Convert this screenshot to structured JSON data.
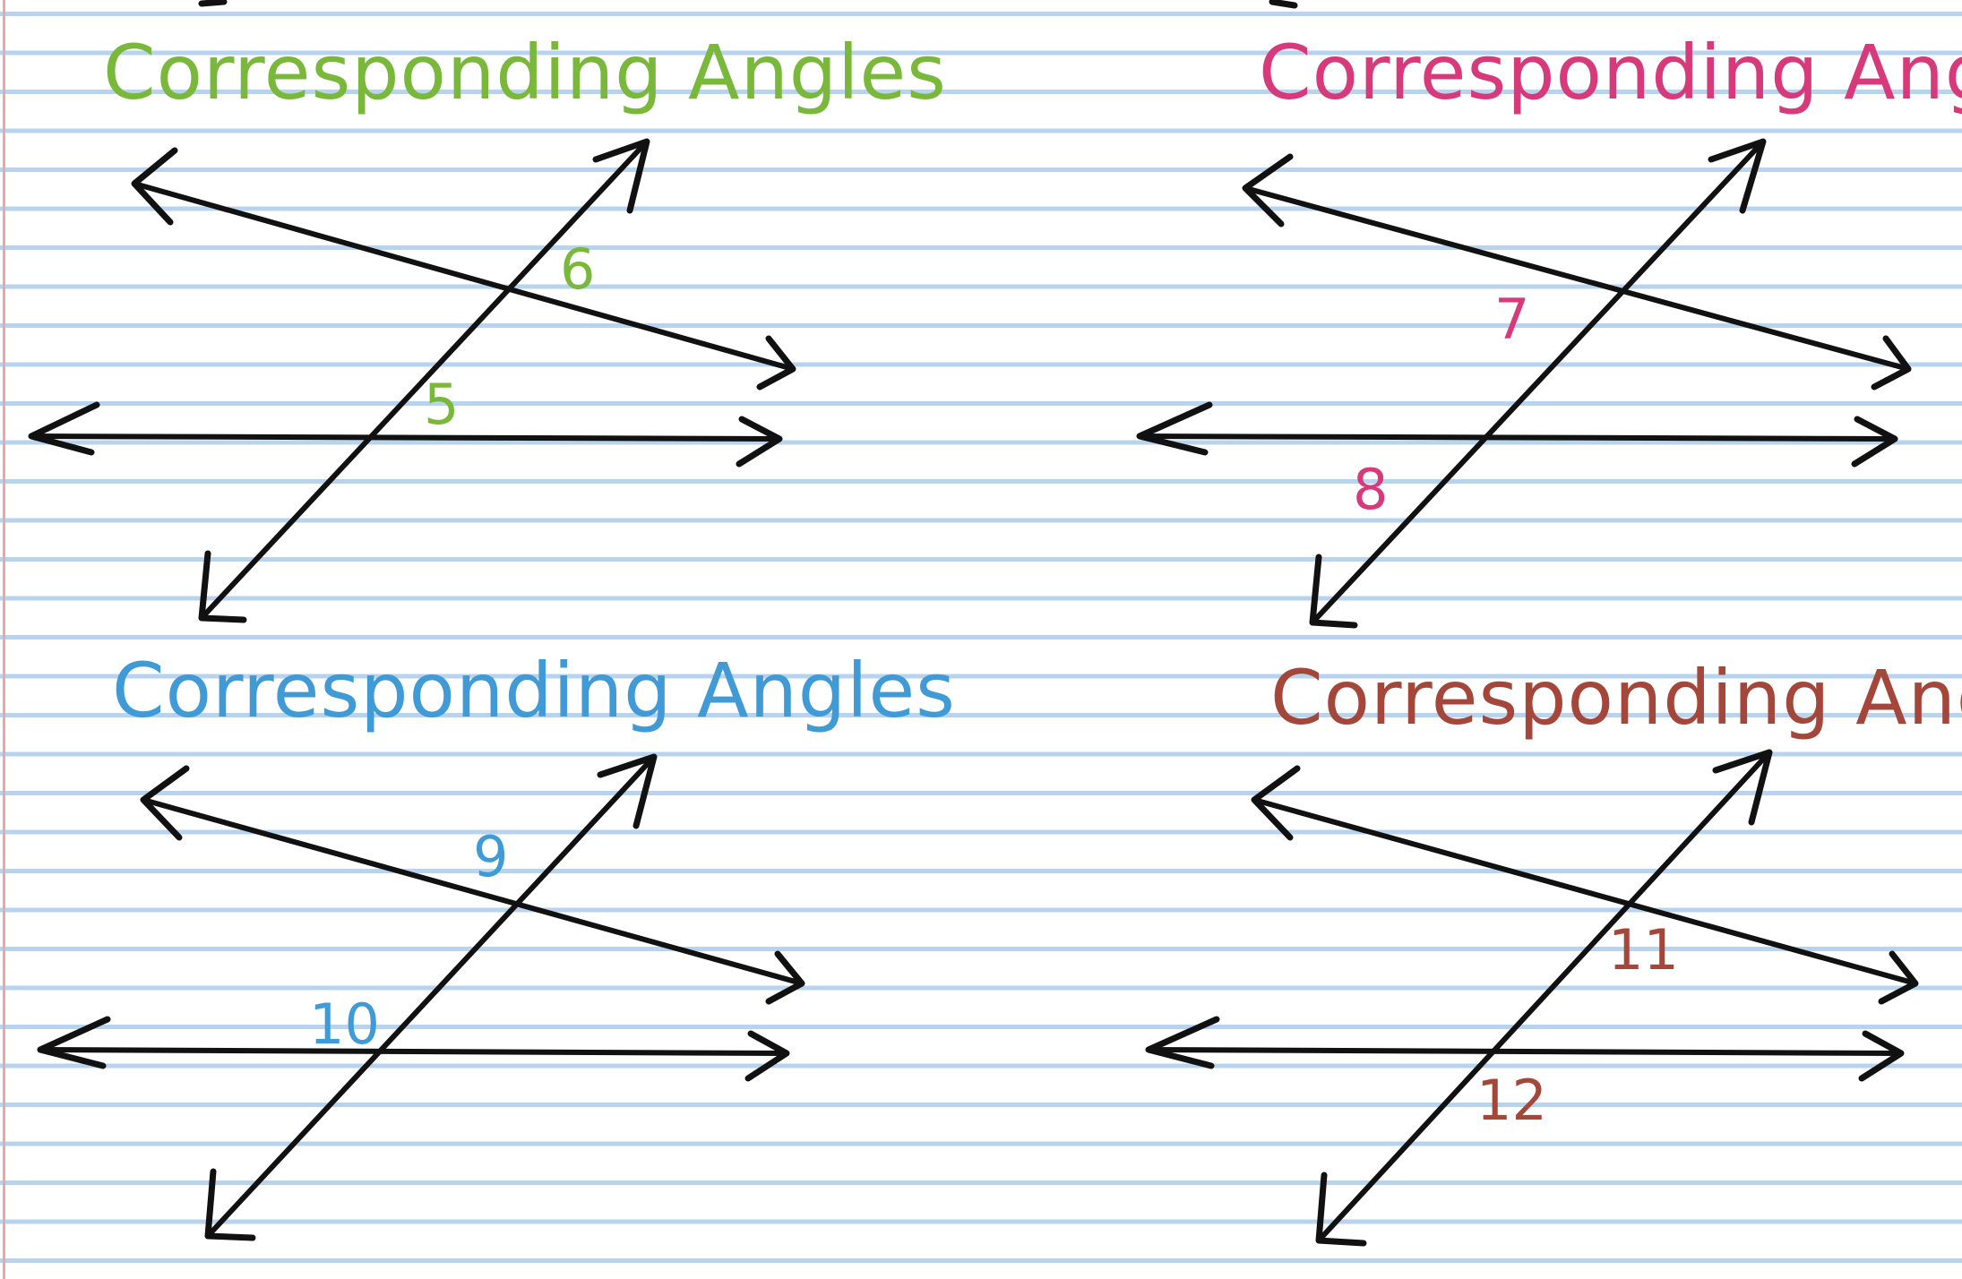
{
  "panels": [
    {
      "title": "Corresponding Angles",
      "color": "#7ab83c",
      "labels": [
        "6",
        "5"
      ]
    },
    {
      "title": "Corresponding Angles",
      "color": "#d63a7a",
      "labels": [
        "7",
        "8"
      ]
    },
    {
      "title": "Corresponding Angles",
      "color": "#3f9ad6",
      "labels": [
        "9",
        "10"
      ]
    },
    {
      "title": "Corresponding Angles",
      "color": "#a5463a",
      "labels": [
        "11",
        "12"
      ]
    }
  ]
}
